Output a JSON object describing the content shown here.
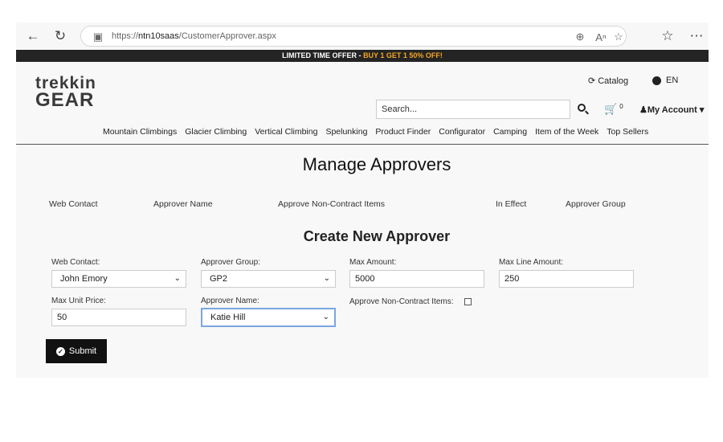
{
  "browser": {
    "url_prefix": "https://",
    "url_host": "ntn10saas",
    "url_path": "/CustomerApprover.aspx",
    "icons": [
      "back-icon",
      "refresh-icon",
      "site-info-icon",
      "zoom-icon",
      "read-aloud-icon",
      "favorite-star-icon",
      "favorites-icon",
      "more-icon"
    ]
  },
  "promo": {
    "label": "LIMITED TIME OFFER - ",
    "deal": "BUY 1 GET 1 50% OFF!"
  },
  "logo": {
    "top": "trekkin",
    "bottom": "GEAR"
  },
  "header": {
    "catalog": "Catalog",
    "language": "EN",
    "search_placeholder": "Search...",
    "cart_count": "0",
    "account": "My Account"
  },
  "nav": [
    "Mountain Climbings",
    "Glacier Climbing",
    "Vertical Climbing",
    "Spelunking",
    "Product Finder",
    "Configurator",
    "Camping",
    "Item of the Week",
    "Top Sellers"
  ],
  "approvers": {
    "title": "Manage Approvers",
    "columns": [
      "Web Contact",
      "Approver Name",
      "Approve Non-Contract Items",
      "In Effect",
      "Approver Group"
    ]
  },
  "form": {
    "title": "Create New Approver",
    "web_contact": {
      "label": "Web Contact:",
      "value": "John Emory"
    },
    "approver_group": {
      "label": "Approver Group:",
      "value": "GP2"
    },
    "max_amount": {
      "label": "Max Amount:",
      "value": "5000"
    },
    "max_line_amount": {
      "label": "Max Line Amount:",
      "value": "250"
    },
    "max_unit_price": {
      "label": "Max Unit Price:",
      "value": "50"
    },
    "approver_name": {
      "label": "Approver Name:",
      "value": "Katie Hill"
    },
    "non_contract": {
      "label": "Approve Non-Contract Items:",
      "checked": false
    },
    "submit": "Submit"
  },
  "colors": {
    "promo_bg": "#242424",
    "promo_accent": "#f5a623",
    "button_bg": "#111111",
    "focus_border": "#7aa7e0"
  }
}
